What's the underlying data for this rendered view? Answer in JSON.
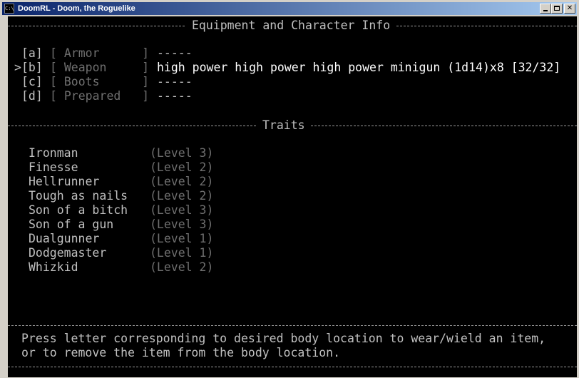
{
  "window": {
    "title": "DoomRL - Doom, the Roguelike",
    "icon_text": "C:\\"
  },
  "equipment": {
    "heading": "Equipment and Character Info",
    "slots": [
      {
        "key": "[a]",
        "label": "[ Armor      ]",
        "item": "-----",
        "selected": false
      },
      {
        "key": "[b]",
        "label": "[ Weapon     ]",
        "item": "high power high power high power minigun (1d14)x8 [32/32]",
        "selected": true
      },
      {
        "key": "[c]",
        "label": "[ Boots      ]",
        "item": "-----",
        "selected": false
      },
      {
        "key": "[d]",
        "label": "[ Prepared   ]",
        "item": "-----",
        "selected": false
      }
    ],
    "cursor": ">"
  },
  "traits": {
    "heading": "Traits",
    "items": [
      {
        "name": "Ironman",
        "level": "(Level 3)"
      },
      {
        "name": "Finesse",
        "level": "(Level 2)"
      },
      {
        "name": "Hellrunner",
        "level": "(Level 2)"
      },
      {
        "name": "Tough as nails",
        "level": "(Level 2)"
      },
      {
        "name": "Son of a bitch",
        "level": "(Level 3)"
      },
      {
        "name": "Son of a gun",
        "level": "(Level 3)"
      },
      {
        "name": "Dualgunner",
        "level": "(Level 1)"
      },
      {
        "name": "Dodgemaster",
        "level": "(Level 1)"
      },
      {
        "name": "Whizkid",
        "level": "(Level 2)"
      }
    ]
  },
  "footer": {
    "line1": "Press letter corresponding to desired body location to wear/wield an item,",
    "line2": "or to remove the item from the body location."
  }
}
